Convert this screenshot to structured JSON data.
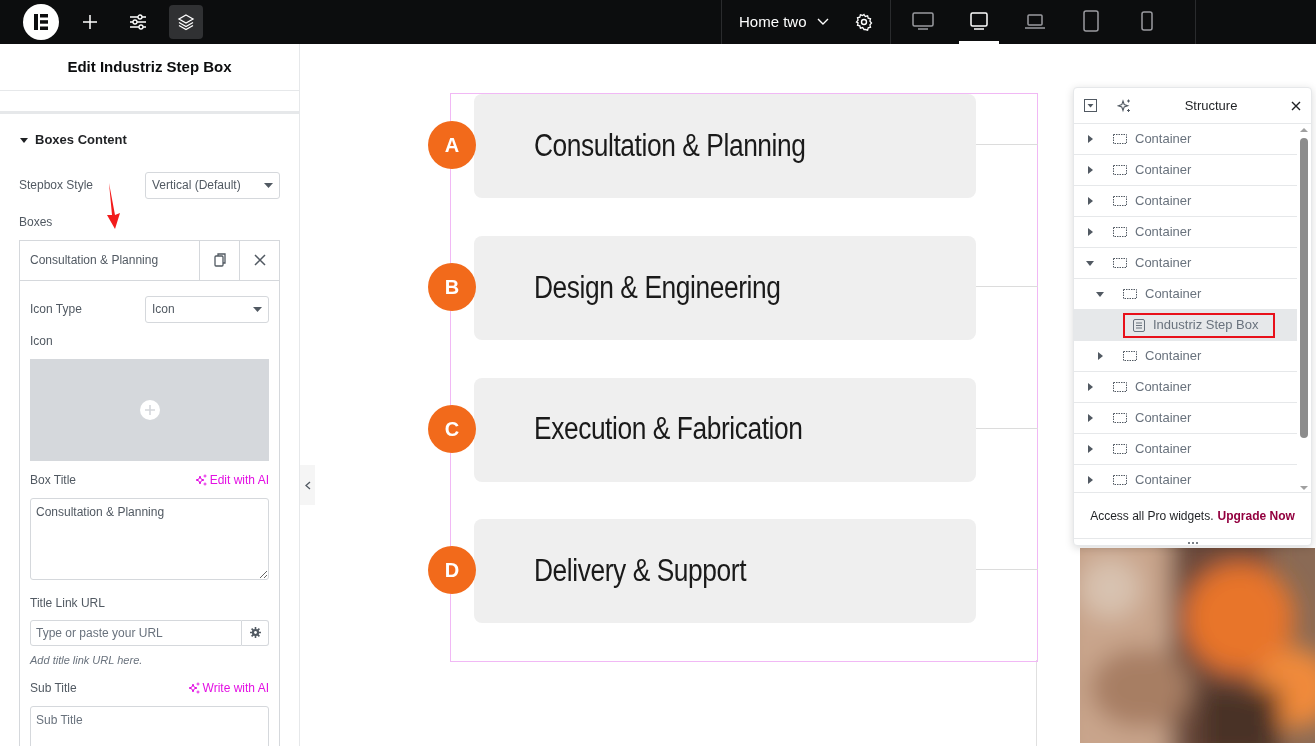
{
  "topbar": {
    "page_title": "Home two",
    "tools": [
      {
        "kind": "add",
        "selected": false
      },
      {
        "kind": "settings",
        "selected": false
      },
      {
        "kind": "structure",
        "selected": true
      }
    ],
    "devices": [
      {
        "kind": "desktop",
        "selected": false
      },
      {
        "kind": "tablet-landscape",
        "selected": true
      },
      {
        "kind": "laptop",
        "selected": false
      },
      {
        "kind": "tablet",
        "selected": false
      },
      {
        "kind": "mobile",
        "selected": false
      }
    ]
  },
  "panel": {
    "title": "Edit Industriz Step Box",
    "section": {
      "title": "Boxes Content",
      "expanded": true
    },
    "stepbox_style": {
      "label": "Stepbox Style",
      "value": "Vertical (Default)"
    },
    "boxes_label": "Boxes",
    "item": {
      "title": "Consultation & Planning",
      "icon_type": {
        "label": "Icon Type",
        "value": "Icon"
      },
      "icon_label": "Icon",
      "box_title": {
        "label": "Box Title",
        "ai": "Edit with AI",
        "value": "Consultation & Planning"
      },
      "title_link": {
        "label": "Title Link URL",
        "placeholder": "Type or paste your URL",
        "hint": "Add title link URL here."
      },
      "sub_title": {
        "label": "Sub Title",
        "ai": "Write with AI",
        "placeholder": "Sub Title"
      }
    }
  },
  "steps": [
    {
      "letter": "A",
      "title": "Consultation & Planning"
    },
    {
      "letter": "B",
      "title": "Design & Engineering"
    },
    {
      "letter": "C",
      "title": "Execution & Fabrication"
    },
    {
      "letter": "D",
      "title": "Delivery & Support"
    }
  ],
  "structure": {
    "title": "Structure",
    "items": [
      {
        "kind": "container",
        "label": "Container",
        "expanded": false,
        "selected": false
      },
      {
        "kind": "container",
        "label": "Container",
        "expanded": false,
        "selected": false
      },
      {
        "kind": "container",
        "label": "Container",
        "expanded": false,
        "selected": false
      },
      {
        "kind": "container",
        "label": "Container",
        "expanded": false,
        "selected": false
      },
      {
        "kind": "container",
        "label": "Container",
        "expanded": true,
        "selected": false,
        "children": [
          {
            "kind": "container",
            "label": "Container",
            "expanded": true,
            "selected": false,
            "children": [
              {
                "kind": "widget",
                "label": "Industriz Step Box",
                "selected": true
              }
            ]
          },
          {
            "kind": "container",
            "label": "Container",
            "expanded": false,
            "selected": false
          }
        ]
      },
      {
        "kind": "container",
        "label": "Container",
        "expanded": false,
        "selected": false
      },
      {
        "kind": "container",
        "label": "Container",
        "expanded": false,
        "selected": false
      },
      {
        "kind": "container",
        "label": "Container",
        "expanded": false,
        "selected": false
      },
      {
        "kind": "container",
        "label": "Container",
        "expanded": false,
        "selected": false
      }
    ],
    "promo": "Access all Pro widgets.",
    "promo_link": "Upgrade Now"
  }
}
